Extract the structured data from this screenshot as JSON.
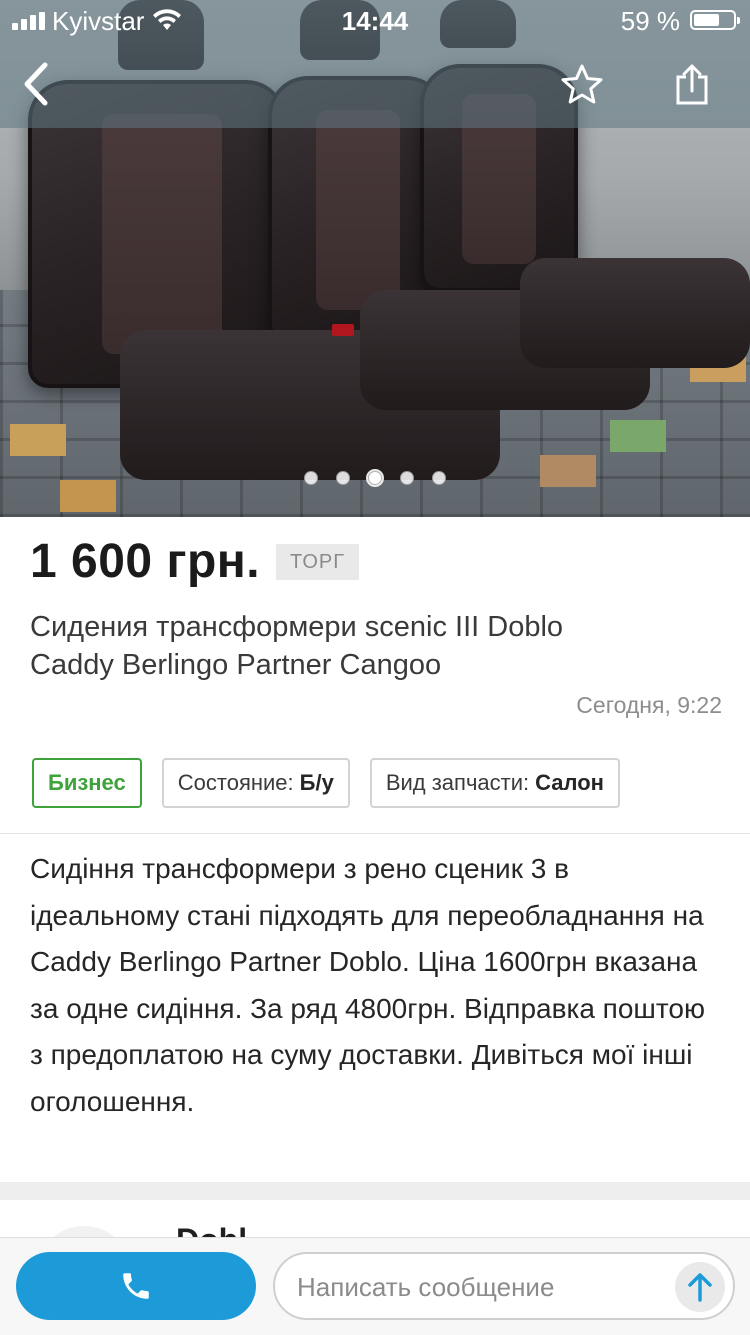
{
  "status_bar": {
    "carrier": "Kyivstar",
    "time": "14:44",
    "battery": "59 %"
  },
  "nav": {
    "back_icon": "chevron-left-icon",
    "favorite_icon": "star-outline-icon",
    "share_icon": "share-icon"
  },
  "gallery": {
    "photo_count": 5,
    "active_index": 2
  },
  "listing": {
    "price": "1 600 грн.",
    "negotiable": "ТОРГ",
    "title": "Сидения трансформери scenic III Doblo Caddy Berlingo Partner Cangoo",
    "date": "Сегодня, 9:22",
    "tags": {
      "business": "Бизнес",
      "condition_label": "Состояние:",
      "condition_value": "Б/у",
      "part_type_label": "Вид запчасти:",
      "part_type_value": "Салон"
    },
    "description": "Сидіння трансформери з рено сценик 3 в ідеальному стані підходять для переобладнання на Caddy Berlingo Partner Doblo. Ціна 1600грн вказана за одне сидіння. За ряд 4800грн. Відправка поштою з предоплатою на суму доставки. Дивіться мої інші оголошення.",
    "seller_peek": "Dobl"
  },
  "bottom_bar": {
    "message_placeholder": "Написать сообщение"
  },
  "colors": {
    "accent_blue": "#1c9bd8",
    "business_green": "#3ea33a"
  }
}
